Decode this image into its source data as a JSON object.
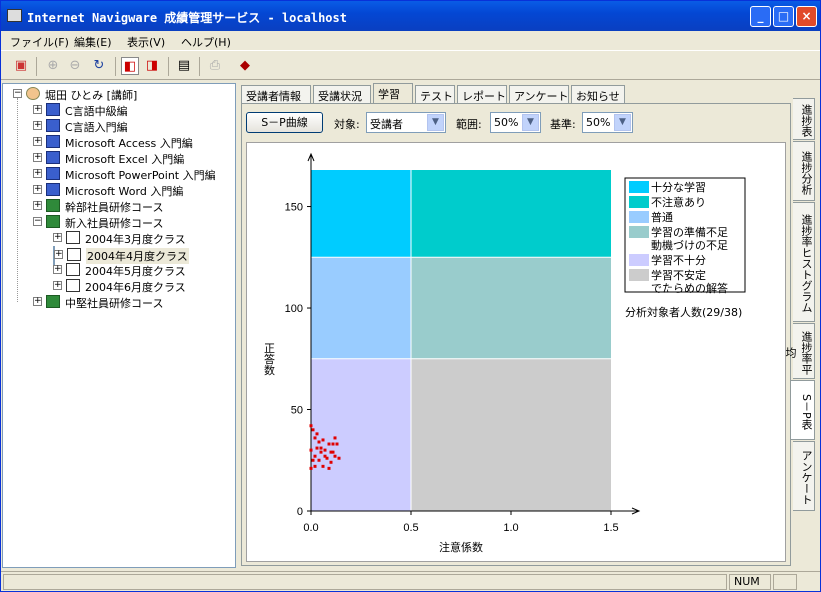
{
  "window": {
    "title": "Internet Navigware 成績管理サービス - localhost",
    "buttons": {
      "minimize": "_",
      "maximize": "□",
      "close": "×"
    }
  },
  "menu": [
    "ファイル(F)",
    "編集(E)",
    "表示(V)",
    "ヘルプ(H)"
  ],
  "toolbar": {
    "icons": [
      "users-icon",
      "zoom-in-icon",
      "zoom-out-icon",
      "refresh-icon",
      "view-a-icon",
      "view-b-icon",
      "preview-icon",
      "print-icon",
      "book-icon"
    ]
  },
  "tree": {
    "root": "堀田 ひとみ [講師]",
    "items": [
      {
        "label": "C言語中級編",
        "type": "pc",
        "level": 1
      },
      {
        "label": "C言語入門編",
        "type": "pc",
        "level": 1
      },
      {
        "label": "Microsoft Access 入門編",
        "type": "pc",
        "level": 1
      },
      {
        "label": "Microsoft Excel 入門編",
        "type": "pc",
        "level": 1
      },
      {
        "label": "Microsoft PowerPoint 入門編",
        "type": "pc",
        "level": 1
      },
      {
        "label": "Microsoft Word 入門編",
        "type": "pc",
        "level": 1
      },
      {
        "label": "幹部社員研修コース",
        "type": "grp",
        "level": 1
      },
      {
        "label": "新入社員研修コース",
        "type": "grp",
        "level": 1,
        "expanded": true
      },
      {
        "label": "2004年3月度クラス",
        "type": "cls",
        "level": 2
      },
      {
        "label": "2004年4月度クラス",
        "type": "cls",
        "level": 2,
        "selected": true
      },
      {
        "label": "2004年5月度クラス",
        "type": "cls",
        "level": 2
      },
      {
        "label": "2004年6月度クラス",
        "type": "cls",
        "level": 2
      },
      {
        "label": "中堅社員研修コース",
        "type": "grp",
        "level": 1
      }
    ]
  },
  "tabs": [
    "受講者情報",
    "受講状況",
    "学習",
    "テスト",
    "レポート",
    "アンケート",
    "お知らせ"
  ],
  "active_tab": "学習",
  "controls": {
    "sp_button": "S－P曲線",
    "target_label": "対象:",
    "target_value": "受講者",
    "range_label": "範囲:",
    "range_value": "50%",
    "criterion_label": "基準:",
    "criterion_value": "50%"
  },
  "side_tabs": [
    "進捗表",
    "進捗分析",
    "進捗率ヒストグラム",
    "進捗率平均",
    "S－P表",
    "アンケート"
  ],
  "active_side_tab": "S－P表",
  "chart_data": {
    "type": "scatter",
    "xlabel": "注意係数",
    "ylabel": "正答数",
    "xlim": [
      0,
      1.5
    ],
    "ylim": [
      0,
      168
    ],
    "xticks": [
      "0.0",
      "0.5",
      "1.0",
      "1.5"
    ],
    "yticks": [
      "0",
      "50",
      "100",
      "150"
    ],
    "regions": [
      {
        "name": "十分な学習",
        "x": [
          0,
          0.5
        ],
        "y": [
          125,
          168
        ],
        "color": "#00ccff"
      },
      {
        "name": "不注意あり",
        "x": [
          0.5,
          1.5
        ],
        "y": [
          125,
          168
        ],
        "color": "#00cccc"
      },
      {
        "name": "普通",
        "x": [
          0,
          0.5
        ],
        "y": [
          75,
          125
        ],
        "color": "#99ccff"
      },
      {
        "name": "学習の準備不足\n動機づけの不足",
        "x": [
          0.5,
          1.5
        ],
        "y": [
          75,
          125
        ],
        "color": "#99cccc"
      },
      {
        "name": "学習不十分",
        "x": [
          0,
          0.5
        ],
        "y": [
          0,
          75
        ],
        "color": "#ccccff"
      },
      {
        "name": "学習不安定\nでたらめの解答",
        "x": [
          0.5,
          1.5
        ],
        "y": [
          0,
          75
        ],
        "color": "#cccccc"
      }
    ],
    "legend": [
      {
        "label": "十分な学習",
        "color": "#00ccff"
      },
      {
        "label": "不注意あり",
        "color": "#00cccc"
      },
      {
        "label": "普通",
        "color": "#99ccff"
      },
      {
        "label": "学習の準備不足",
        "label2": "動機づけの不足",
        "color": "#99cccc"
      },
      {
        "label": "学習不十分",
        "color": "#ccccff"
      },
      {
        "label": "学習不安定",
        "label2": "でたらめの解答",
        "color": "#cccccc"
      }
    ],
    "legend_position": "top-right",
    "note": "分析対象者人数(29/38)",
    "points": [
      [
        0.0,
        42
      ],
      [
        0.01,
        40
      ],
      [
        0.02,
        36
      ],
      [
        0.04,
        34
      ],
      [
        0.03,
        31
      ],
      [
        0.0,
        30
      ],
      [
        0.05,
        29
      ],
      [
        0.07,
        27
      ],
      [
        0.02,
        27
      ],
      [
        0.1,
        24
      ],
      [
        0.06,
        22
      ],
      [
        0.0,
        21
      ],
      [
        0.12,
        36
      ],
      [
        0.11,
        33
      ],
      [
        0.13,
        33
      ],
      [
        0.09,
        33
      ],
      [
        0.14,
        26
      ],
      [
        0.08,
        26
      ],
      [
        0.1,
        29
      ],
      [
        0.07,
        30
      ],
      [
        0.01,
        25
      ],
      [
        0.04,
        25
      ],
      [
        0.02,
        22
      ],
      [
        0.09,
        21
      ],
      [
        0.12,
        27
      ],
      [
        0.03,
        38
      ],
      [
        0.05,
        31
      ],
      [
        0.11,
        29
      ],
      [
        0.06,
        35
      ]
    ]
  },
  "status": {
    "num": "NUM"
  }
}
